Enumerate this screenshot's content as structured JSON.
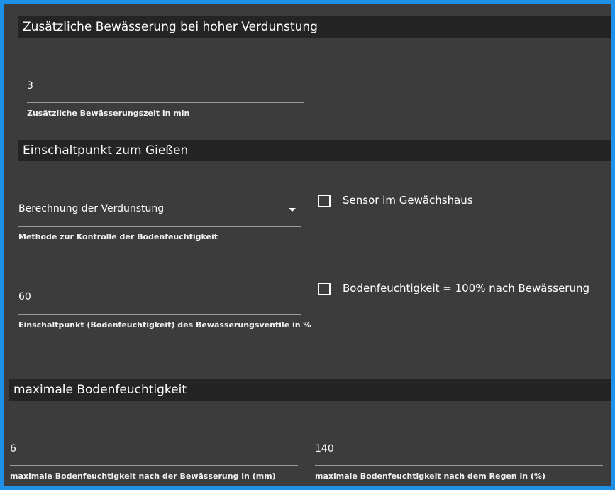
{
  "sections": {
    "extra_irrigation": {
      "title": "Zusätzliche Bewässerung bei hoher Verdunstung",
      "time_field": {
        "value": "3",
        "help": "Zusätzliche Bewässerungszeit in min"
      }
    },
    "switch_point": {
      "title": "Einschaltpunkt zum Gießen",
      "method_select": {
        "value": "Berechnung der Verdunstung",
        "help": "Methode zur Kontrolle der Bodenfeuchtigkeit"
      },
      "switch_field": {
        "value": "60",
        "help": "Einschaltpunkt (Bodenfeuchtigkeit) des Bewässerungsventile in %"
      },
      "checkbox_greenhouse": {
        "label": "Sensor im Gewächshaus",
        "checked": false
      },
      "checkbox_soil_full": {
        "label": "Bodenfeuchtigkeit = 100% nach Bewässerung",
        "checked": false
      }
    },
    "max_soil": {
      "title": "maximale Bodenfeuchtigkeit",
      "after_irrigation": {
        "value": "6",
        "help": "maximale Bodenfeuchtigkeit nach der Bewässerung in (mm)"
      },
      "after_rain": {
        "value": "140",
        "help": "maximale Bodenfeuchtigkeit nach dem Regen in (%)"
      }
    }
  },
  "icons": {
    "dropdown": "chevron-down-icon",
    "checkbox": "checkbox-unchecked-icon"
  },
  "colors": {
    "frame_border": "#1e90e6",
    "background": "#3c3c3c",
    "header_background": "#242424"
  }
}
